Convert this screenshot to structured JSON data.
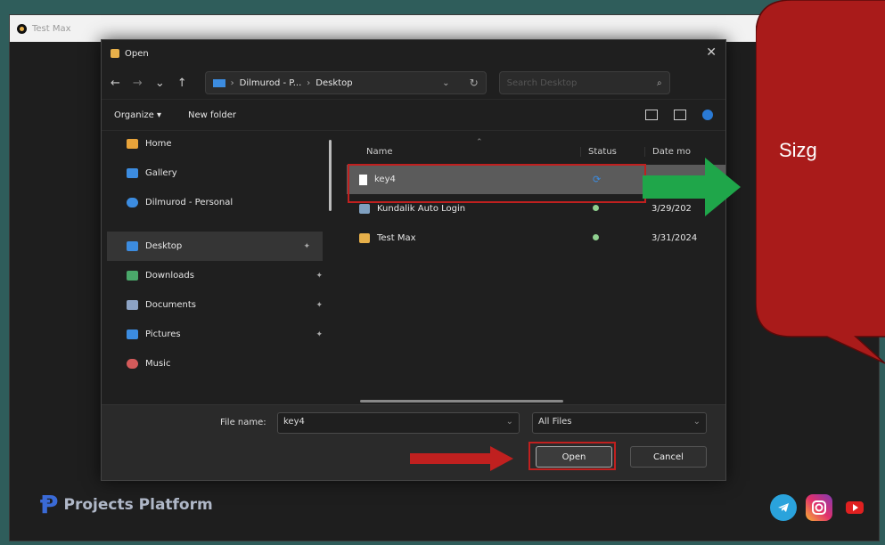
{
  "app": {
    "title": "Test Max"
  },
  "dialog": {
    "title": "Open",
    "close": "✕",
    "nav": {
      "back": "←",
      "forward": "→",
      "recent": "⌄",
      "up": "↑"
    },
    "breadcrumb": [
      "Dilmurod - P...",
      "Desktop"
    ],
    "search_placeholder": "Search Desktop",
    "toolbar": {
      "organize": "Organize ▾",
      "new_folder": "New folder"
    },
    "sidebar": {
      "top": [
        {
          "label": "Home",
          "color": "#e8a33a"
        },
        {
          "label": "Gallery",
          "color": "#3c8ce0"
        },
        {
          "label": "Dilmurod - Personal",
          "color": "#3c8ce0"
        }
      ],
      "pinned": [
        {
          "label": "Desktop",
          "color": "#3c8ce0",
          "selected": true
        },
        {
          "label": "Downloads",
          "color": "#4aa86a"
        },
        {
          "label": "Documents",
          "color": "#8da3c4"
        },
        {
          "label": "Pictures",
          "color": "#3c8ce0"
        },
        {
          "label": "Music",
          "color": "#d35a5a"
        }
      ]
    },
    "columns": {
      "name": "Name",
      "status": "Status",
      "date": "Date mo"
    },
    "files": [
      {
        "name": "key4",
        "status": "sync",
        "date": "",
        "selected": true
      },
      {
        "name": "Kundalik Auto Login",
        "status": "ok",
        "date": "3/29/202"
      },
      {
        "name": "Test Max",
        "status": "ok",
        "date": "3/31/2024"
      }
    ],
    "file_name_label": "File name:",
    "file_name_value": "key4",
    "file_type": "All Files",
    "open_button": "Open",
    "cancel_button": "Cancel"
  },
  "brand": "Projects Platform",
  "callout": {
    "text": "Sizg"
  },
  "colors": {
    "accent": "#c0201f",
    "green_arrow": "#1fa64a",
    "callout_bg": "#a91b1a"
  }
}
